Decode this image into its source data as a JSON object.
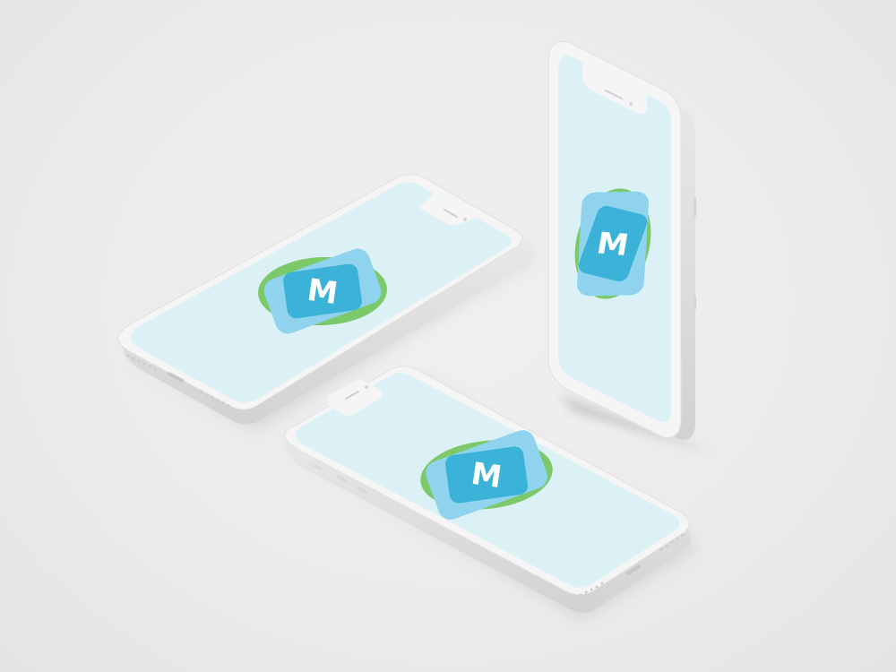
{
  "scene": {
    "description_label": "",
    "phones": [
      {
        "id": "left-phone",
        "logo_letter": "M"
      },
      {
        "id": "bottom-phone",
        "logo_letter": "M"
      },
      {
        "id": "upright-phone",
        "logo_letter": "M"
      }
    ]
  },
  "colors": {
    "background": "#ececec",
    "phone_body": "#f4f4f4",
    "screen": "#dcf1f5",
    "logo_blue": "#3bb3d9",
    "logo_light_blue": "#8fd3ee",
    "logo_green": "#7cc96a"
  },
  "icons": {
    "logo": "m-logo-icon",
    "speaker": "speaker-grille-icon",
    "camera": "camera-dot-icon",
    "port": "lightning-port-icon"
  }
}
